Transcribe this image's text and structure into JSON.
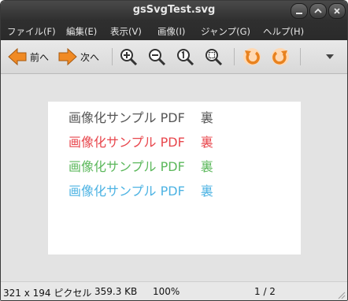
{
  "window": {
    "title": "gsSvgTest.svg"
  },
  "window_controls": {
    "minimize": "_",
    "maximize": "^",
    "close": "x"
  },
  "menu": [
    {
      "label": "ファイル(F)"
    },
    {
      "label": "編集(E)"
    },
    {
      "label": "表示(V)"
    },
    {
      "label": "画像(I)"
    },
    {
      "label": "ジャンプ(G)"
    },
    {
      "label": "ヘルプ(H)"
    }
  ],
  "toolbar": {
    "prev_label": "前へ",
    "next_label": "次へ",
    "icons": [
      "arrow-left-icon",
      "arrow-right-icon",
      "zoom-in-icon",
      "zoom-out-icon",
      "zoom-100-icon",
      "zoom-fit-icon",
      "rotate-left-icon",
      "rotate-right-icon",
      "dropdown-icon"
    ]
  },
  "document": {
    "lines": [
      {
        "text": "画像化サンプル PDF",
        "suffix": "裏",
        "color": "#555555"
      },
      {
        "text": "画像化サンプル PDF",
        "suffix": "裏",
        "color": "#e8474d"
      },
      {
        "text": "画像化サンプル PDF",
        "suffix": "裏",
        "color": "#5cb85c"
      },
      {
        "text": "画像化サンプル PDF",
        "suffix": "裏",
        "color": "#4db3e3"
      }
    ]
  },
  "status": {
    "dimensions": "321 x 194 ピクセル",
    "size": "359.3 KB",
    "zoom": "100%",
    "page": "1 / 2"
  },
  "colors": {
    "accent_orange": "#e8821f",
    "titlebar": "#3a3a3a"
  }
}
